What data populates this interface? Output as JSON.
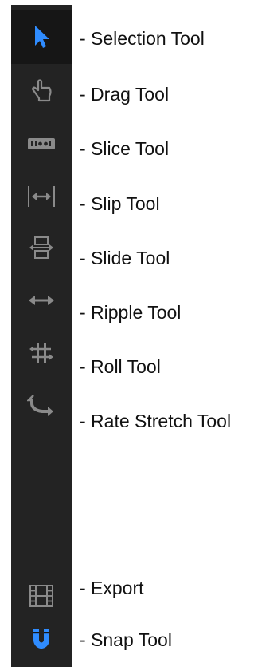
{
  "tools": [
    {
      "id": "selection",
      "label": "- Selection Tool",
      "icon": "selection-arrow-icon"
    },
    {
      "id": "drag",
      "label": "- Drag Tool",
      "icon": "drag-hand-icon"
    },
    {
      "id": "slice",
      "label": "- Slice Tool",
      "icon": "slice-blade-icon"
    },
    {
      "id": "slip",
      "label": "- Slip Tool",
      "icon": "slip-arrows-icon"
    },
    {
      "id": "slide",
      "label": "- Slide Tool",
      "icon": "slide-icon"
    },
    {
      "id": "ripple",
      "label": "- Ripple Tool",
      "icon": "ripple-arrows-icon"
    },
    {
      "id": "roll",
      "label": "- Roll Tool",
      "icon": "roll-icon"
    },
    {
      "id": "rate-stretch",
      "label": "- Rate Stretch Tool",
      "icon": "rate-stretch-icon"
    },
    {
      "id": "export",
      "label": "- Export",
      "icon": "film-strip-icon"
    },
    {
      "id": "snap",
      "label": "- Snap Tool",
      "icon": "magnet-icon"
    }
  ],
  "colors": {
    "toolbar_bg": "#232323",
    "active_bg": "#161616",
    "icon_gray": "#8a8a8a",
    "accent_blue": "#2f8cff",
    "label_text": "#111111"
  }
}
